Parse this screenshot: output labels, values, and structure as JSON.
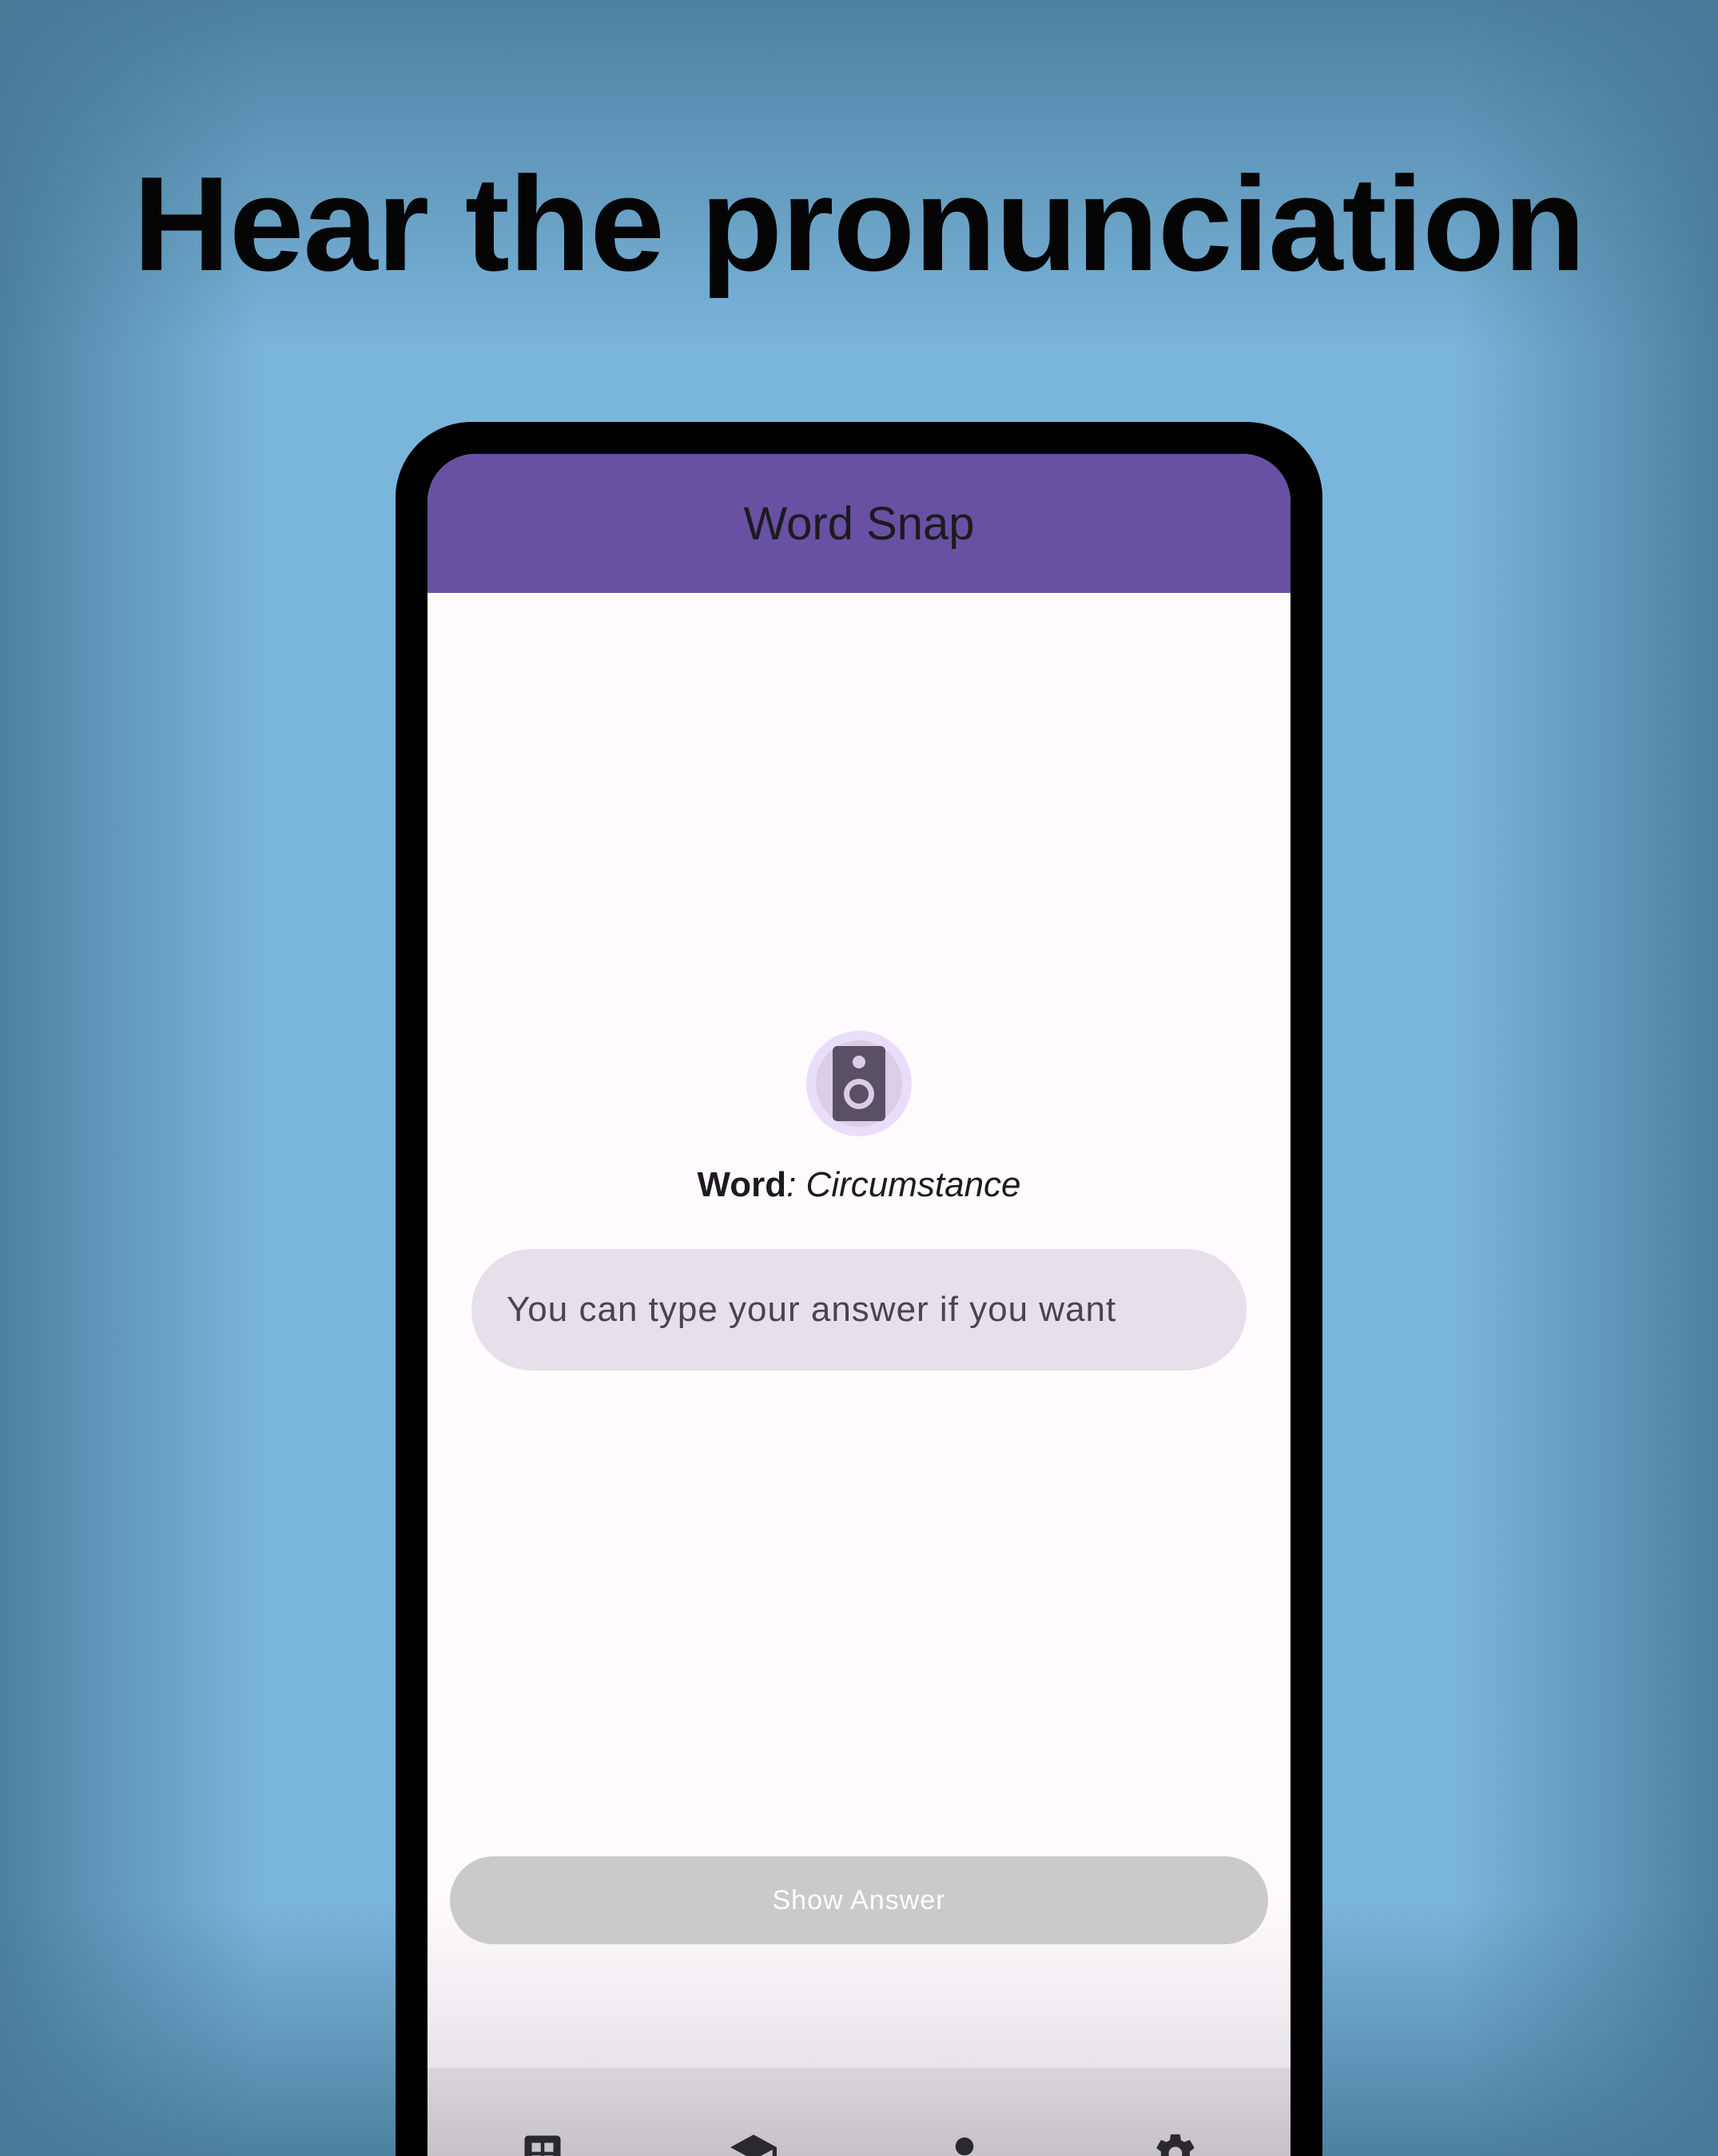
{
  "headline": "Hear the pronunciation",
  "app": {
    "title": "Word Snap"
  },
  "quiz": {
    "word_label": "Word",
    "word_separator": ": ",
    "word_value": "Circumstance",
    "speaker_icon": "speaker-icon",
    "answer_placeholder": "You can type your answer if you want",
    "answer_value": "",
    "show_answer_label": "Show Answer"
  },
  "bottom_nav": {
    "items": [
      {
        "icon": "dashboard-icon"
      },
      {
        "icon": "school-icon"
      },
      {
        "icon": "person-icon"
      },
      {
        "icon": "settings-icon"
      }
    ]
  },
  "colors": {
    "background": "#7ab5dc",
    "app_bar": "#6851a3",
    "speaker_circle": "#e9defa",
    "speaker_icon": "#5a5066",
    "field_bg": "#e6e0ea",
    "disabled_button": "#cacaca"
  }
}
